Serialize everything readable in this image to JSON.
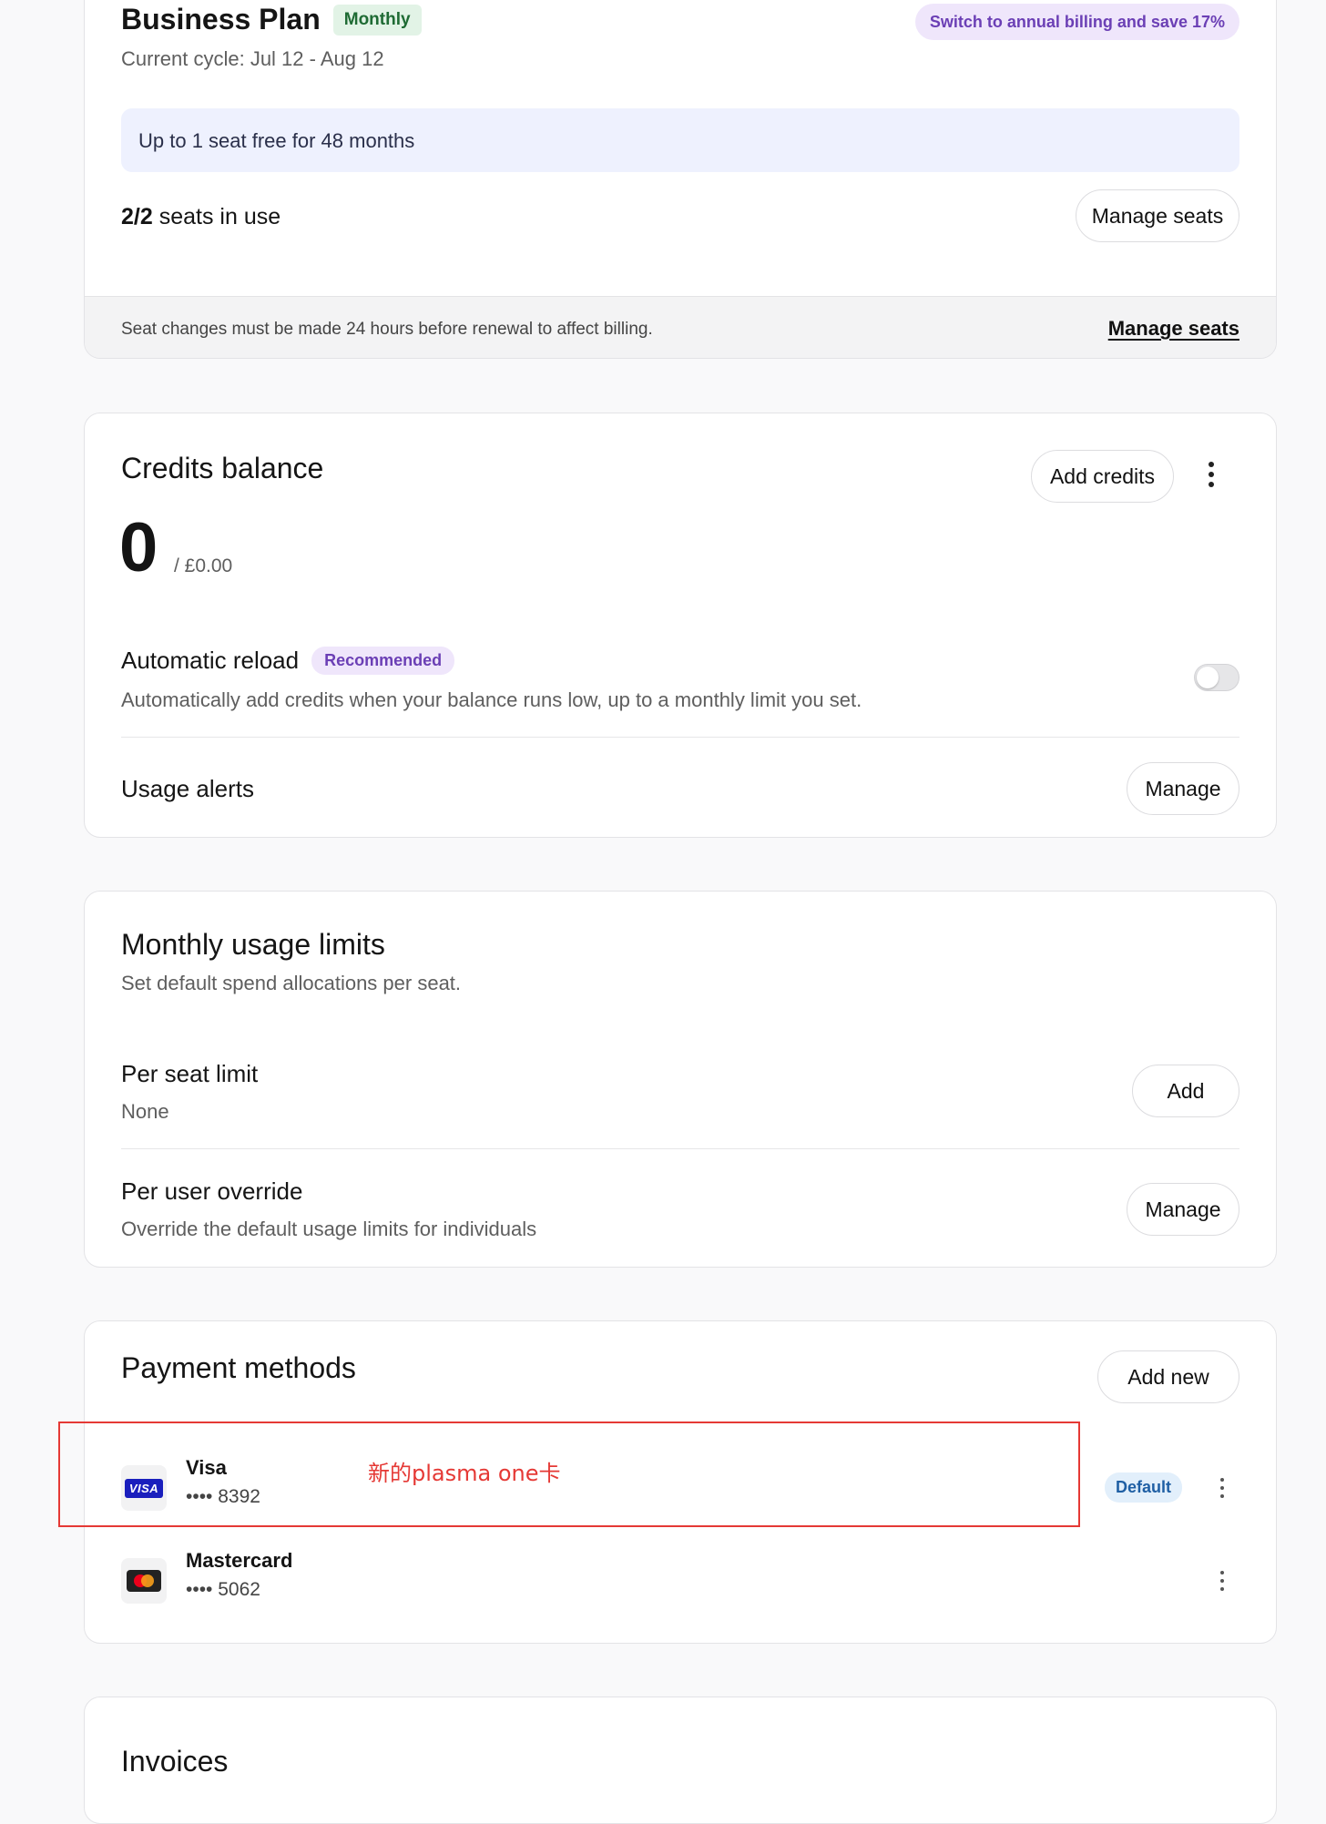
{
  "plan": {
    "title": "Business Plan",
    "badge": "Monthly",
    "annual_cta": "Switch to annual billing and save 17%",
    "cycle": "Current cycle: Jul 12 - Aug 12",
    "promo": "Up to 1 seat free for 48 months",
    "seats_count": "2/2",
    "seats_label": " seats in use",
    "manage_seats_button": "Manage seats",
    "footer_note": "Seat changes must be made 24 hours before renewal to affect billing.",
    "footer_link": "Manage seats"
  },
  "credits": {
    "title": "Credits balance",
    "add_button": "Add credits",
    "balance": "0",
    "balance_currency": "/ £0.00",
    "auto_reload_title": "Automatic reload",
    "auto_reload_badge": "Recommended",
    "auto_reload_desc": "Automatically add credits when your balance runs low, up to a monthly limit you set.",
    "auto_reload_enabled": false,
    "usage_alerts_title": "Usage alerts",
    "usage_alerts_button": "Manage"
  },
  "limits": {
    "title": "Monthly usage limits",
    "subtitle": "Set default spend allocations per seat.",
    "per_seat_title": "Per seat limit",
    "per_seat_value": "None",
    "per_seat_button": "Add",
    "override_title": "Per user override",
    "override_desc": "Override the default usage limits for individuals",
    "override_button": "Manage"
  },
  "payment": {
    "title": "Payment methods",
    "add_button": "Add new",
    "cards": [
      {
        "brand": "Visa",
        "number": "•••• 8392",
        "logo_text": "VISA",
        "default_badge": "Default"
      },
      {
        "brand": "Mastercard",
        "number": "•••• 5062"
      }
    ],
    "annotation": "新的plasma one卡"
  },
  "invoices": {
    "title": "Invoices"
  },
  "colors": {
    "monthly_badge_bg": "#e2f3e6",
    "monthly_badge_fg": "#1f6b34",
    "annual_bg": "#efe6fb",
    "annual_fg": "#6b3fb5",
    "promo_bg": "#eef1fe",
    "recommended_bg": "#efe6fb",
    "recommended_fg": "#6b3fb5",
    "default_bg": "#e2effb",
    "default_fg": "#1f5fa4",
    "annotation_red": "#e53935",
    "visa_blue": "#1a1fbd"
  },
  "icons": [
    "more-vertical-icon",
    "visa-logo-icon",
    "mastercard-logo-icon",
    "toggle-switch"
  ]
}
